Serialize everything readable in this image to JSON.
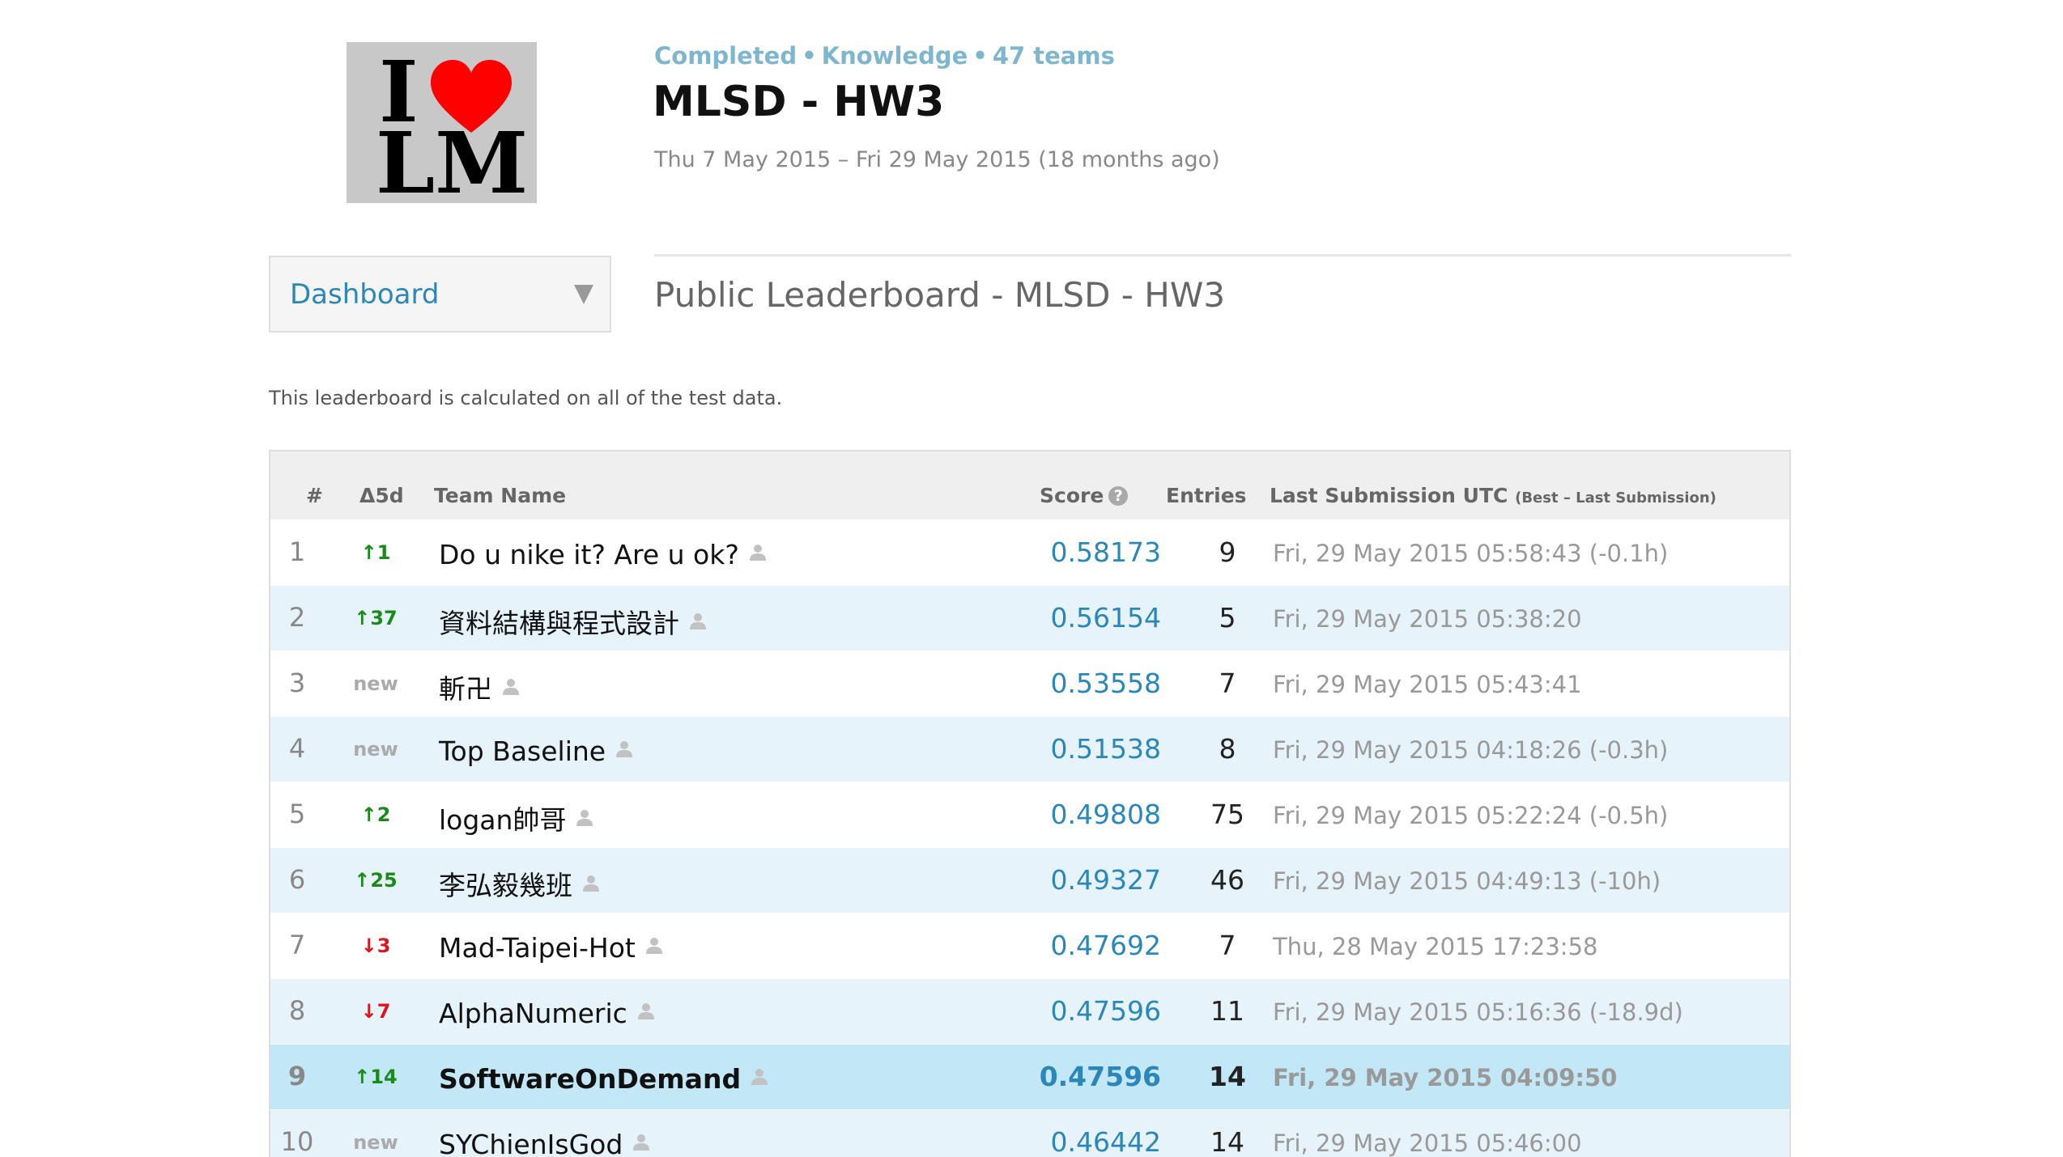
{
  "logo": {
    "line1": "I",
    "line2": "LM",
    "heart_color": "#ff0000"
  },
  "header": {
    "status": "Completed",
    "category": "Knowledge",
    "teams": "47 teams",
    "separator": "•",
    "title": "MLSD - HW3",
    "date_range": "Thu 7 May 2015 – Fri 29 May 2015 (18 months ago)"
  },
  "nav": {
    "dropdown_label": "Dashboard",
    "caret_icon": "chevron-down-icon"
  },
  "leaderboard": {
    "title": "Public Leaderboard - MLSD - HW3",
    "note": "This leaderboard is calculated on all of the test data.",
    "columns": {
      "rank": "#",
      "delta": "Δ5d",
      "team": "Team Name",
      "score": "Score",
      "score_help": "?",
      "entries": "Entries",
      "last": "Last Submission UTC",
      "last_sub": "(Best – Last Submission)"
    },
    "rows": [
      {
        "rank": "1",
        "delta": "↑1",
        "delta_type": "up",
        "team": "Do u nike it? Are u ok?",
        "score": "0.58173",
        "entries": "9",
        "last": "Fri, 29 May 2015 05:58:43 (-0.1h)"
      },
      {
        "rank": "2",
        "delta": "↑37",
        "delta_type": "up",
        "team": "資料結構與程式設計",
        "score": "0.56154",
        "entries": "5",
        "last": "Fri, 29 May 2015 05:38:20"
      },
      {
        "rank": "3",
        "delta": "new",
        "delta_type": "new",
        "team": "斬卍",
        "score": "0.53558",
        "entries": "7",
        "last": "Fri, 29 May 2015 05:43:41"
      },
      {
        "rank": "4",
        "delta": "new",
        "delta_type": "new",
        "team": "Top Baseline",
        "score": "0.51538",
        "entries": "8",
        "last": "Fri, 29 May 2015 04:18:26 (-0.3h)"
      },
      {
        "rank": "5",
        "delta": "↑2",
        "delta_type": "up",
        "team": "logan帥哥",
        "score": "0.49808",
        "entries": "75",
        "last": "Fri, 29 May 2015 05:22:24 (-0.5h)"
      },
      {
        "rank": "6",
        "delta": "↑25",
        "delta_type": "up",
        "team": "李弘毅幾班",
        "score": "0.49327",
        "entries": "46",
        "last": "Fri, 29 May 2015 04:49:13 (-10h)"
      },
      {
        "rank": "7",
        "delta": "↓3",
        "delta_type": "down",
        "team": "Mad-Taipei-Hot",
        "score": "0.47692",
        "entries": "7",
        "last": "Thu, 28 May 2015 17:23:58"
      },
      {
        "rank": "8",
        "delta": "↓7",
        "delta_type": "down",
        "team": "AlphaNumeric",
        "score": "0.47596",
        "entries": "11",
        "last": "Fri, 29 May 2015 05:16:36 (-18.9d)"
      },
      {
        "rank": "9",
        "delta": "↑14",
        "delta_type": "up",
        "team": "SoftwareOnDemand",
        "score": "0.47596",
        "entries": "14",
        "last": "Fri, 29 May 2015 04:09:50",
        "highlight": true
      },
      {
        "rank": "10",
        "delta": "new",
        "delta_type": "new",
        "team": "SYChienIsGod",
        "score": "0.46442",
        "entries": "14",
        "last": "Fri, 29 May 2015 05:46:00"
      }
    ]
  }
}
